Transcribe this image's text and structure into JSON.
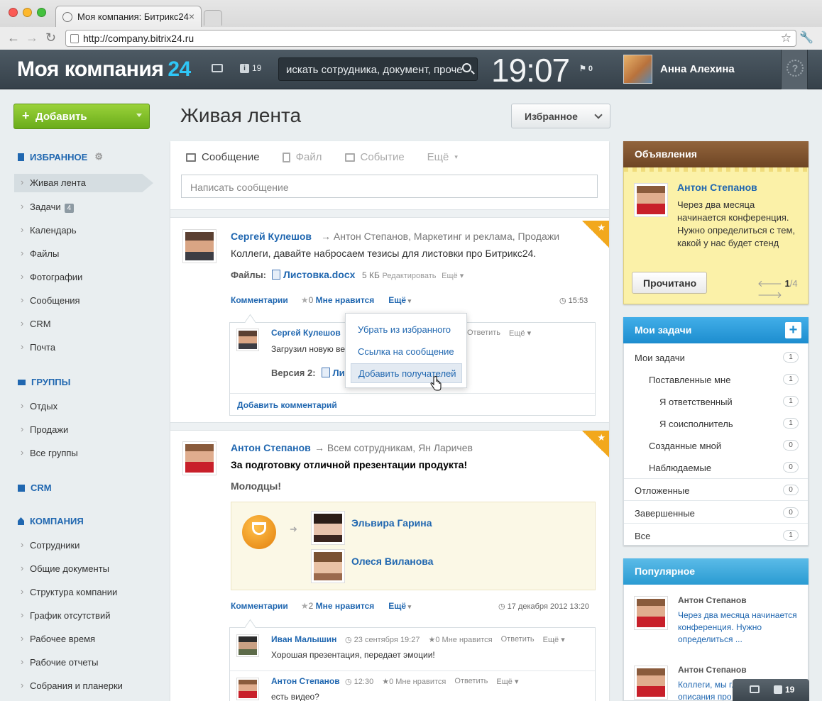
{
  "browser": {
    "tab_title": "Моя компания: Битрикс24",
    "url": "http://company.bitrix24.ru"
  },
  "header": {
    "logo_text": "Моя компания",
    "logo_number": "24",
    "notifications_count": "19",
    "search_placeholder": "искать сотрудника, документ, проче",
    "clock": "19:07",
    "flags_count": "0",
    "user_name": "Анна Алехина"
  },
  "sidebar": {
    "add_button": "Добавить",
    "favorites_title": "ИЗБРАННОЕ",
    "favorites": [
      {
        "label": "Живая лента"
      },
      {
        "label": "Задачи",
        "badge": "4"
      },
      {
        "label": "Календарь"
      },
      {
        "label": "Файлы"
      },
      {
        "label": "Фотографии"
      },
      {
        "label": "Сообщения"
      },
      {
        "label": "CRM"
      },
      {
        "label": "Почта"
      }
    ],
    "groups_title": "ГРУППЫ",
    "groups": [
      {
        "label": "Отдых"
      },
      {
        "label": "Продажи"
      },
      {
        "label": "Все группы"
      }
    ],
    "crm_title": "CRM",
    "company_title": "КОМПАНИЯ",
    "company": [
      {
        "label": "Сотрудники"
      },
      {
        "label": "Общие документы"
      },
      {
        "label": "Структура компании"
      },
      {
        "label": "График отсутствий"
      },
      {
        "label": "Рабочее время"
      },
      {
        "label": "Рабочие отчеты"
      },
      {
        "label": "Собрания и планерки"
      }
    ]
  },
  "main": {
    "title": "Живая лента",
    "filter_button": "Избранное",
    "composer": {
      "tabs": [
        "Сообщение",
        "Файл",
        "Событие",
        "Ещё"
      ],
      "placeholder": "Написать сообщение"
    },
    "post1": {
      "author": "Сергей Кулешов",
      "recipients": "Антон Степанов, Маркетинг и реклама, Продажи",
      "text": "Коллеги, давайте набросаем тезисы для листовки про Битрикс24.",
      "files_label": "Файлы:",
      "file_name": "Листовка.docx",
      "file_size": "5 КБ",
      "file_edit": "Редактировать",
      "file_more": "Ещё",
      "comments": "Комментарии",
      "likes": "0",
      "like_label": "Мне нравится",
      "more": "Ещё",
      "time": "15:53",
      "comment": {
        "author": "Сергей Кулешов",
        "text": "Загрузил новую ве",
        "version_label": "Версия 2:",
        "version_file": "Ли",
        "reply": "Ответить",
        "more": "Ещё"
      },
      "add_comment": "Добавить комментарий"
    },
    "popup_menu": [
      "Убрать из избранного",
      "Ссылка на сообщение",
      "Добавить получателей"
    ],
    "post2": {
      "author": "Антон Степанов",
      "recipients": "Всем сотрудникам, Ян Ларичев",
      "text": "За подготовку отличной презентации продукта!",
      "text2": "Молодцы!",
      "recipients_grat": [
        "Эльвира Гарина",
        "Олеся Виланова"
      ],
      "comments": "Комментарии",
      "likes": "2",
      "like_label": "Мне нравится",
      "more": "Ещё",
      "time": "17 декабря 2012 13:20",
      "comment1": {
        "author": "Иван Малышин",
        "time": "23 сентября 19:27",
        "likes": "0",
        "like_label": "Мне нравится",
        "reply": "Ответить",
        "more": "Ещё",
        "text": "Хорошая презентация, передает эмоции!"
      },
      "comment2": {
        "author": "Антон Степанов",
        "time": "12:30",
        "likes": "0",
        "like_label": "Мне нравится",
        "reply": "Ответить",
        "more": "Ещё",
        "text": "есть видео?"
      }
    }
  },
  "right": {
    "announcements": {
      "title": "Объявления",
      "author": "Антон Степанов",
      "text": "Через два месяца начинается конференция. Нужно определиться с тем, какой у нас будет стенд",
      "read_button": "Прочитано",
      "page_current": "1",
      "page_total": "4"
    },
    "tasks": {
      "title": "Мои задачи",
      "rows": [
        {
          "label": "Мои задачи",
          "count": "1"
        },
        {
          "label": "Поставленные мне",
          "count": "1"
        },
        {
          "label": "Я ответственный",
          "count": "1"
        },
        {
          "label": "Я соисполнитель",
          "count": "1"
        },
        {
          "label": "Созданные мной",
          "count": "0"
        },
        {
          "label": "Наблюдаемые",
          "count": "0"
        },
        {
          "label": "Отложенные",
          "count": "0"
        },
        {
          "label": "Завершенные",
          "count": "0"
        },
        {
          "label": "Все",
          "count": "1"
        }
      ]
    },
    "popular": {
      "title": "Популярное",
      "items": [
        {
          "author": "Антон Степанов",
          "text": "Через два месяца начинается конференция. Нужно определиться ..."
        },
        {
          "author": "Антон Степанов",
          "text": "Коллеги, мы г... описания про"
        }
      ]
    }
  },
  "bottom_bar": {
    "count": "19"
  }
}
